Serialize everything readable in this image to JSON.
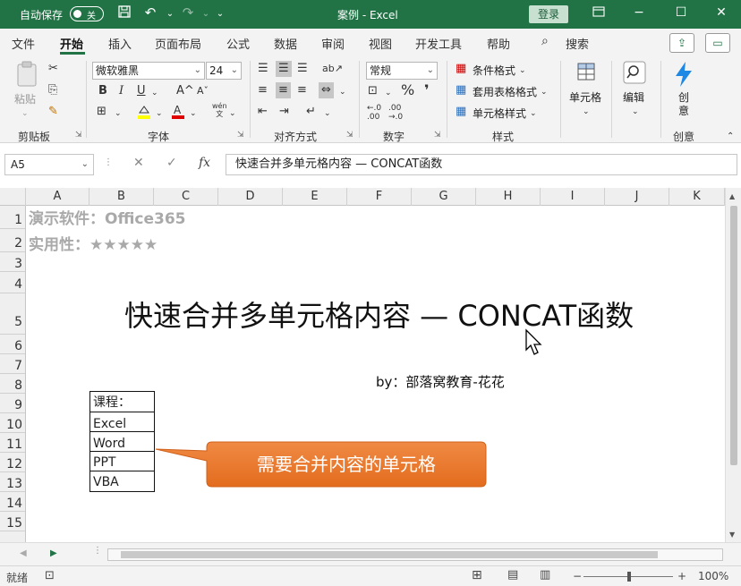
{
  "titlebar": {
    "autosave_label": "自动保存",
    "autosave_state": "关",
    "doc_title": "案例 - Excel",
    "login_label": "登录"
  },
  "tabs": [
    "文件",
    "开始",
    "插入",
    "页面布局",
    "公式",
    "数据",
    "审阅",
    "视图",
    "开发工具",
    "帮助"
  ],
  "search_label": "搜索",
  "ribbon": {
    "clipboard": {
      "paste": "粘贴",
      "label": "剪贴板"
    },
    "font": {
      "name": "微软雅黑",
      "size": "24",
      "label": "字体",
      "grow": "A",
      "shrink": "A",
      "wen": "wén"
    },
    "alignment": {
      "label": "对齐方式"
    },
    "number": {
      "format": "常规",
      "label": "数字"
    },
    "styles": {
      "cond": "条件格式",
      "table": "套用表格格式",
      "cell": "单元格样式",
      "label": "样式"
    },
    "cells": {
      "label": "单元格"
    },
    "editing": {
      "label": "编辑"
    },
    "creative": {
      "btn": "创\n意",
      "label": "创意"
    }
  },
  "formula_bar": {
    "name_box": "A5",
    "content": "快速合并多单元格内容 — CONCAT函数"
  },
  "columns": [
    "A",
    "B",
    "C",
    "D",
    "E",
    "F",
    "G",
    "H",
    "I",
    "J",
    "K"
  ],
  "rows": [
    "1",
    "2",
    "3",
    "4",
    "5",
    "6",
    "7",
    "8",
    "9",
    "10",
    "11",
    "12",
    "13",
    "14",
    "15"
  ],
  "sheet": {
    "demo_software": "演示软件：Office365",
    "practicality": "实用性：★★★★★",
    "title": "快速合并多单元格内容 — CONCAT函数",
    "byline": "by：部落窝教育-花花",
    "courses": [
      "课程：",
      "Excel",
      "Word",
      "PPT",
      "VBA"
    ],
    "callout": "需要合并内容的单元格"
  },
  "status": {
    "ready": "就绪",
    "zoom": "100%",
    "zoom_minus": "−",
    "zoom_plus": "+"
  },
  "colors": {
    "excel_green": "#217346",
    "callout_orange": "#ed7d31",
    "demo_gray": "#a9a9a9"
  }
}
